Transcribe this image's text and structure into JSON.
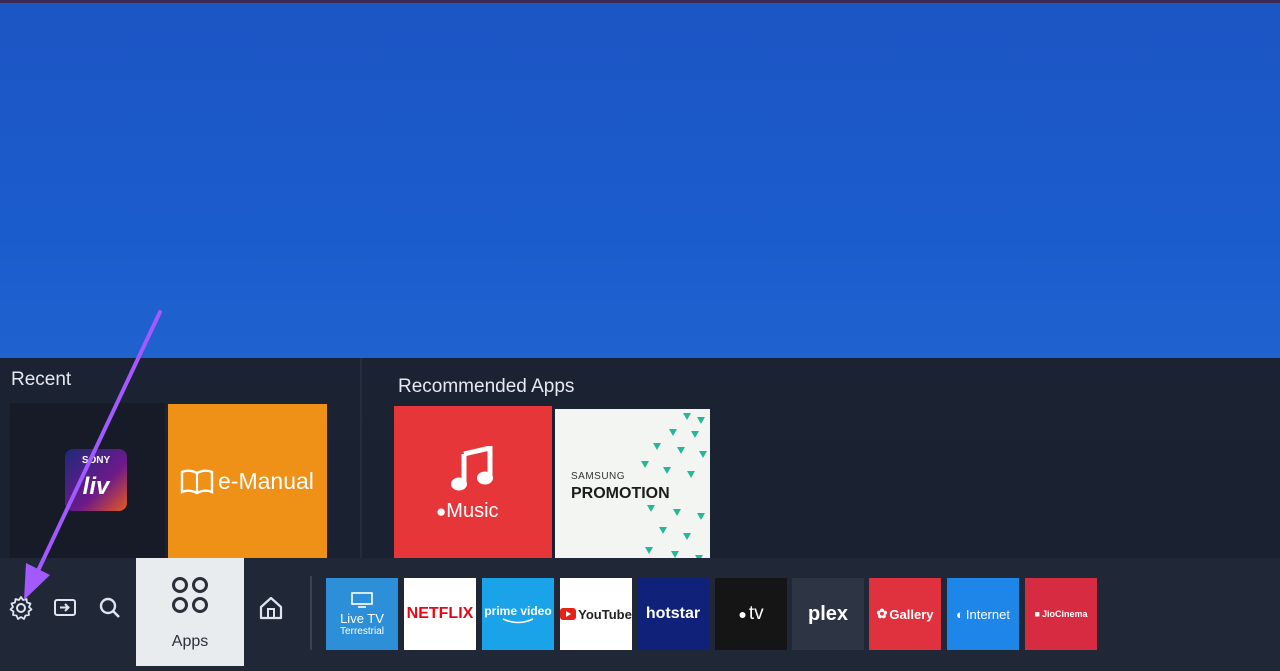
{
  "recent": {
    "title": "Recent",
    "items": [
      {
        "name": "SONY liv",
        "brand_top": "SONY",
        "brand_bottom": "liv"
      },
      {
        "name": "e-Manual",
        "label": "e-Manual"
      }
    ]
  },
  "recommended": {
    "title": "Recommended Apps",
    "items": [
      {
        "name": "Music",
        "label": "Music"
      },
      {
        "name": "Samsung Promotion",
        "top": "SAMSUNG",
        "bottom": "PROMOTION"
      }
    ]
  },
  "bar": {
    "apps_label": "Apps",
    "apps": [
      {
        "id": "live-tv",
        "line1": "Live TV",
        "line2": "Terrestrial",
        "bg": "#2d8fd8"
      },
      {
        "id": "netflix",
        "label": "NETFLIX",
        "bg": "#ffffff",
        "fg": "#e50914"
      },
      {
        "id": "prime-video",
        "label": "prime video",
        "bg": "#1aa3e8"
      },
      {
        "id": "youtube",
        "label": "YouTube",
        "bg": "#ffffff",
        "fg": "#222222"
      },
      {
        "id": "hotstar",
        "label": "hotstar",
        "bg": "#10217a"
      },
      {
        "id": "apple-tv",
        "label": "tv",
        "bg": "#151515"
      },
      {
        "id": "plex",
        "label": "plex",
        "bg": "#2d3544"
      },
      {
        "id": "gallery",
        "label": "Gallery",
        "bg": "#e0323e"
      },
      {
        "id": "internet",
        "label": "Internet",
        "bg": "#1e86e8"
      },
      {
        "id": "jiocinema",
        "label": "JioCinema",
        "bg": "#d72b42"
      }
    ]
  },
  "icons": [
    "settings-icon",
    "source-icon",
    "search-icon",
    "home-icon",
    "apps-grid-icon"
  ],
  "colors": {
    "screen": "#1b5ccc",
    "panel": "#1b2233",
    "annotation_arrow": "#a259ff"
  }
}
